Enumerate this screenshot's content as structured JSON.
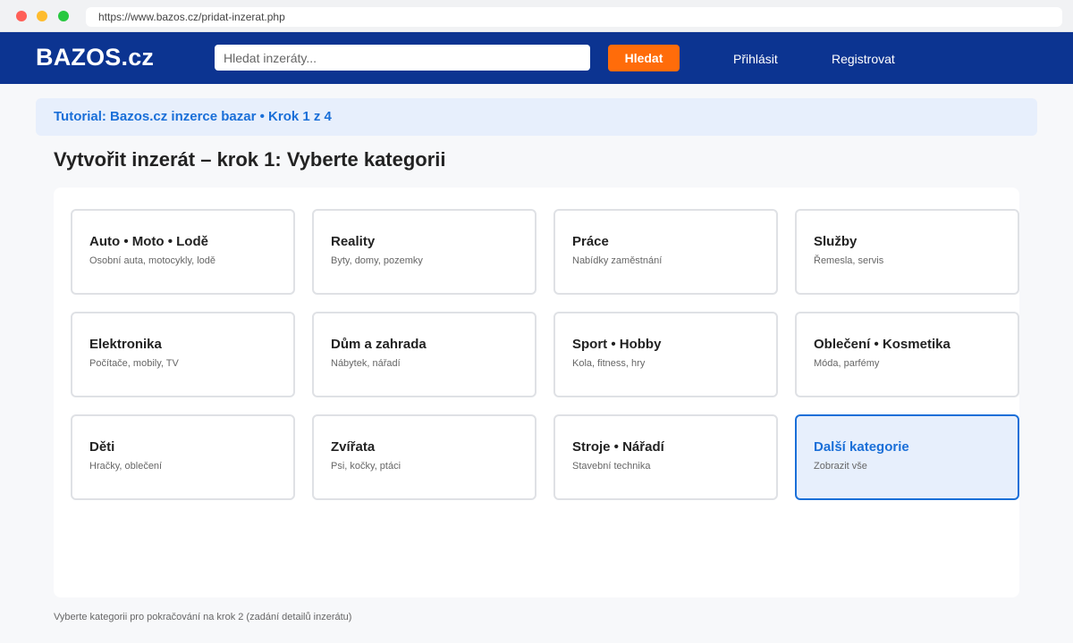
{
  "browser": {
    "url": "https://www.bazos.cz/pridat-inzerat.php"
  },
  "header": {
    "logo": "BAZOS.cz",
    "search_placeholder": "Hledat inzeráty...",
    "search_button": "Hledat",
    "login": "Přihlásit",
    "register": "Registrovat"
  },
  "tutorial_banner": "Tutorial: Bazos.cz inzerce bazar • Krok 1 z 4",
  "page_title": "Vytvořit inzerát – krok 1: Vyberte kategorii",
  "categories": [
    {
      "title": "Auto • Moto • Lodě",
      "subtitle": "Osobní auta, motocykly, lodě"
    },
    {
      "title": "Reality",
      "subtitle": "Byty, domy, pozemky"
    },
    {
      "title": "Práce",
      "subtitle": "Nabídky zaměstnání"
    },
    {
      "title": "Služby",
      "subtitle": "Řemesla, servis"
    },
    {
      "title": "Elektronika",
      "subtitle": "Počítače, mobily, TV"
    },
    {
      "title": "Dům a zahrada",
      "subtitle": "Nábytek, nářadí"
    },
    {
      "title": "Sport • Hobby",
      "subtitle": "Kola, fitness, hry"
    },
    {
      "title": "Oblečení • Kosmetika",
      "subtitle": "Móda, parfémy"
    },
    {
      "title": "Děti",
      "subtitle": "Hračky, oblečení"
    },
    {
      "title": "Zvířata",
      "subtitle": "Psi, kočky, ptáci"
    },
    {
      "title": "Stroje • Nářadí",
      "subtitle": "Stavební technika"
    },
    {
      "title": "Další kategorie",
      "subtitle": "Zobrazit vše"
    }
  ],
  "footer_note": "Vyberte kategorii pro pokračování na krok 2 (zadání detailů inzerátu)",
  "colors": {
    "header_bg": "#0c3491",
    "accent": "#1a6fd8",
    "search_button": "#ff6c0a"
  }
}
